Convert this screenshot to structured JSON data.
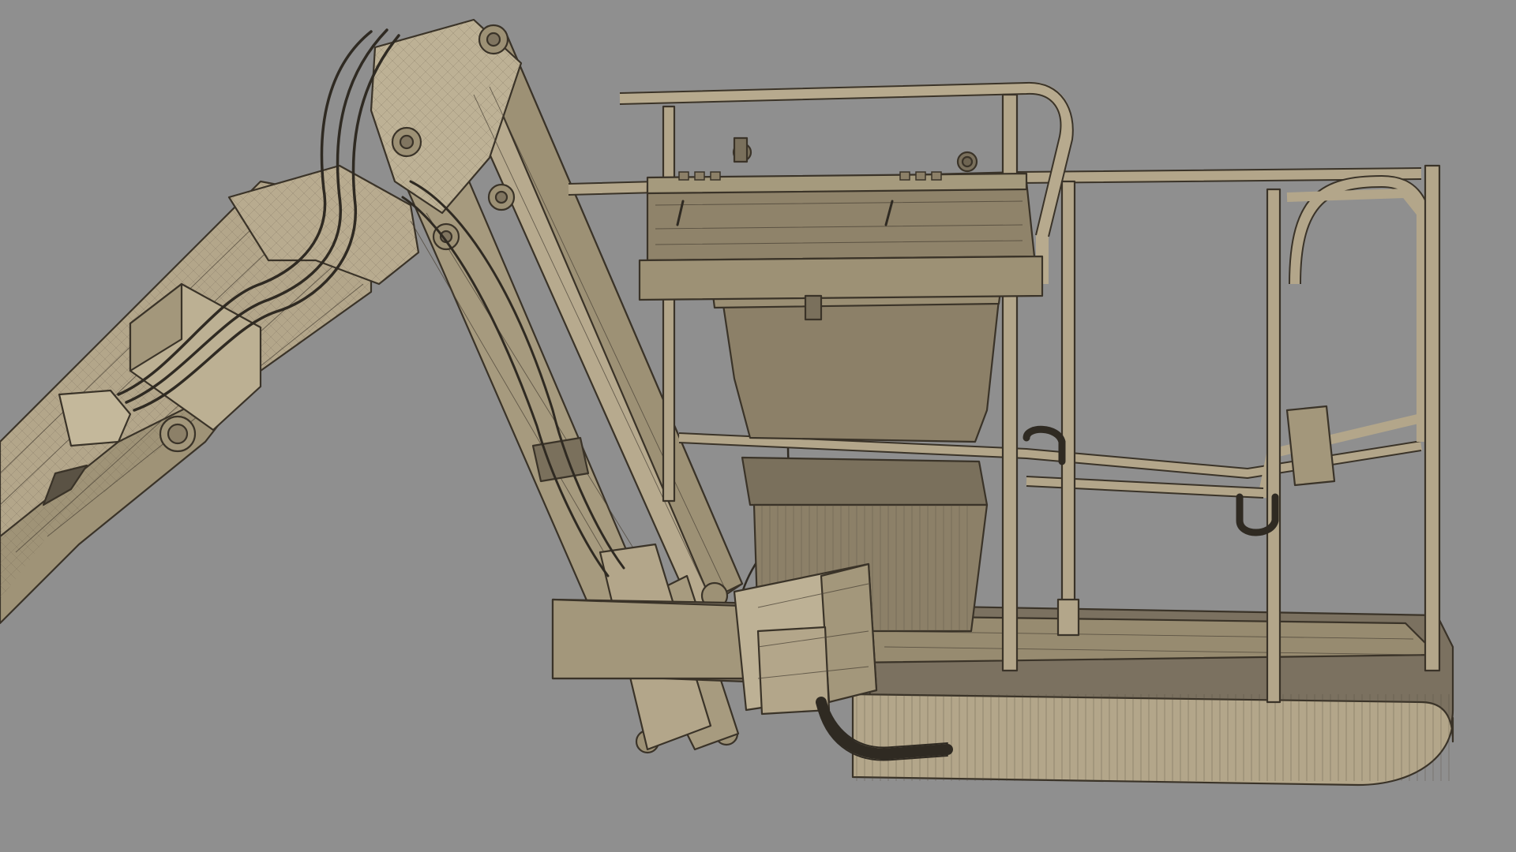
{
  "scene": {
    "background_color": "#8f8f8f",
    "material_color": "#b3a68a",
    "material_shadow_color": "#8c8068",
    "material_dark_color": "#6f6552",
    "wire_color": "#3a3328"
  }
}
